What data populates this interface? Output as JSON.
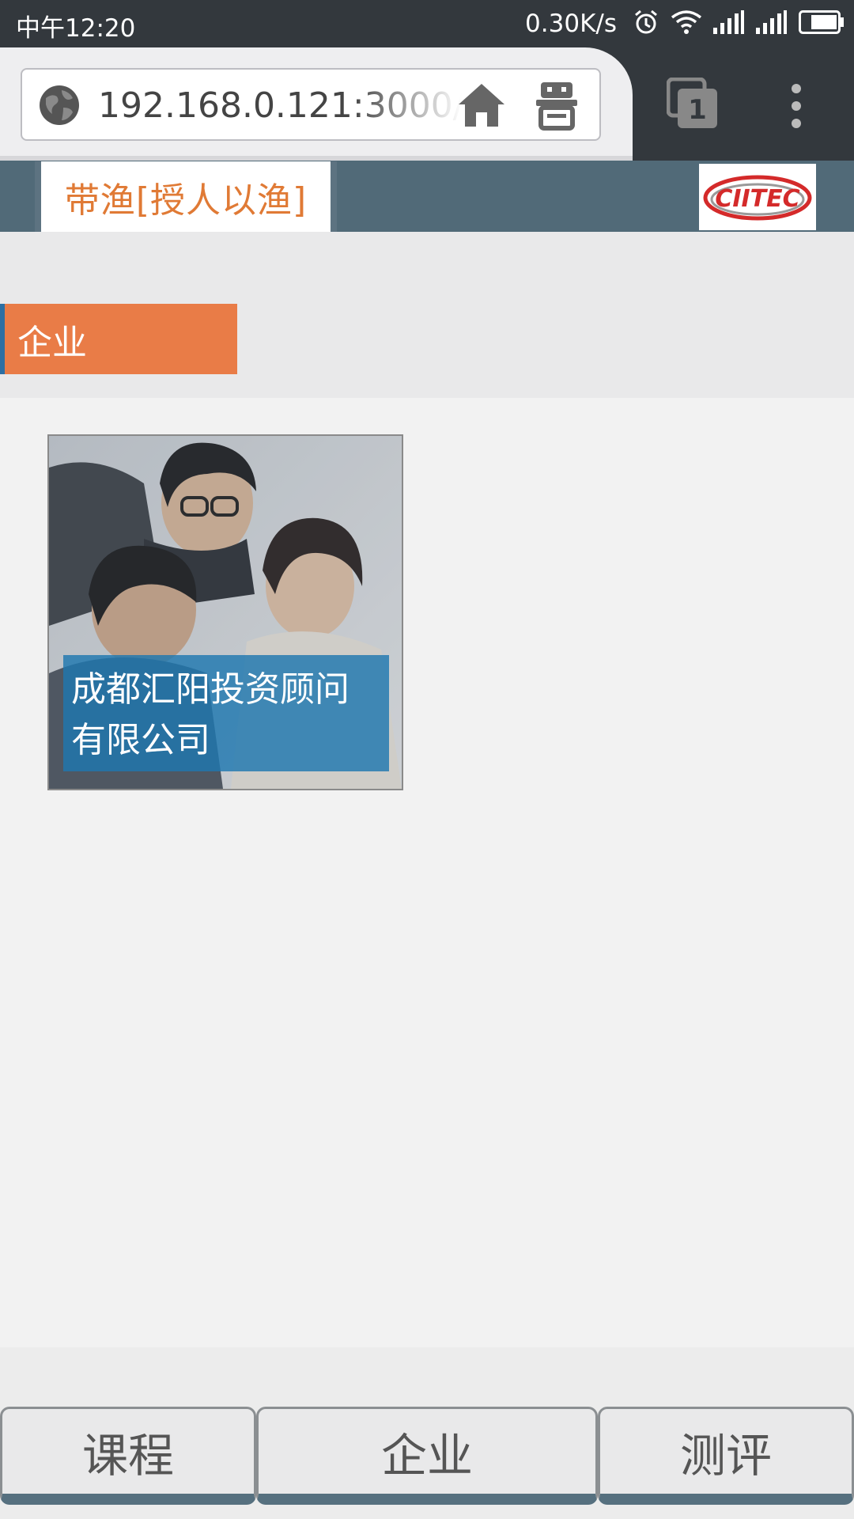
{
  "status_bar": {
    "time": "中午12:20",
    "network_speed": "0.30K/s"
  },
  "browser": {
    "url": "192.168.0.121:3000/r",
    "tab_count": "1"
  },
  "header": {
    "brand_title": "带渔[授人以渔]",
    "logo_text": "CIITEC"
  },
  "section": {
    "tag": "企业"
  },
  "card": {
    "caption": "成都汇阳投资顾问有限公司",
    "caption_line1": "成都汇阳投资顾问",
    "caption_line2": "有限公司"
  },
  "bottom_nav": {
    "items": [
      {
        "label": "课程"
      },
      {
        "label": "企业"
      },
      {
        "label": "测评"
      }
    ]
  },
  "colors": {
    "status_bg": "#33383d",
    "header_bg": "#516a78",
    "brand_orange": "#e07a35",
    "tag_orange": "#e97c47",
    "caption_blue": "#1e78b0"
  }
}
